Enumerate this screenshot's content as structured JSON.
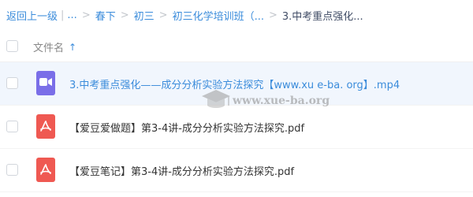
{
  "breadcrumb": {
    "back_label": "返回上一级",
    "ellipsis": "...",
    "items": [
      "春下",
      "初三",
      "初三化学培训班（..."
    ],
    "current": "3.中考重点强化..."
  },
  "header": {
    "column_title": "文件名",
    "sort_arrow": "↑"
  },
  "files": [
    {
      "name": "3.中考重点强化——成分分析实验方法探究【www.xu e-ba. org】.mp4",
      "type": "video",
      "selected": true
    },
    {
      "name": "【爱豆爱做题】第3-4讲-成分分析实验方法探究.pdf",
      "type": "pdf",
      "selected": false
    },
    {
      "name": "【爱豆笔记】第3-4讲-成分分析实验方法探究.pdf",
      "type": "pdf",
      "selected": false
    }
  ],
  "watermark": {
    "text": "www.xue-ba.org"
  },
  "colors": {
    "accent": "#3b8cdb",
    "video_icon": "#7a6ee8",
    "pdf_icon": "#ef5952",
    "selected_row": "#f1f6fd"
  }
}
